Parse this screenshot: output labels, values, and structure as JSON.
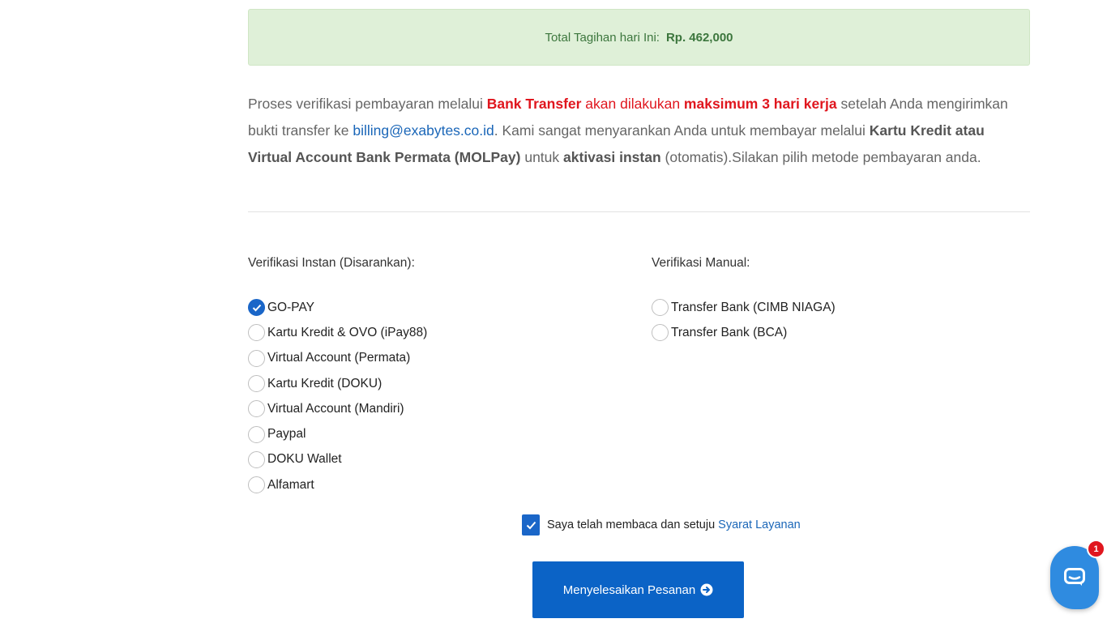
{
  "total": {
    "label": "Total Tagihan hari Ini:",
    "amount": "Rp. 462,000"
  },
  "notice": {
    "p1": "Proses verifikasi pembayaran melalui ",
    "bank_transfer": "Bank Transfer",
    "p2": " akan dilakukan ",
    "max_days": "maksimum 3 hari kerja",
    "p3": " setelah Anda mengirimkan bukti transfer ke ",
    "email": "billing@exabytes.co.id",
    "p4": ". Kami sangat menyarankan Anda untuk membayar melalui ",
    "recommended": "Kartu Kredit atau Virtual Account Bank Permata (MOLPay)",
    "p5": " untuk ",
    "instant": "aktivasi instan",
    "p6": " (otomatis).Silakan pilih metode pembayaran anda."
  },
  "instant_section": {
    "title": "Verifikasi Instan (Disarankan):",
    "options": [
      {
        "label": "GO-PAY",
        "checked": true
      },
      {
        "label": "Kartu Kredit & OVO (iPay88)",
        "checked": false
      },
      {
        "label": "Virtual Account (Permata)",
        "checked": false
      },
      {
        "label": "Kartu Kredit (DOKU)",
        "checked": false
      },
      {
        "label": "Virtual Account (Mandiri)",
        "checked": false
      },
      {
        "label": "Paypal",
        "checked": false
      },
      {
        "label": "DOKU Wallet",
        "checked": false
      },
      {
        "label": "Alfamart",
        "checked": false
      }
    ]
  },
  "manual_section": {
    "title": "Verifikasi Manual:",
    "options": [
      {
        "label": "Transfer Bank (CIMB NIAGA)",
        "checked": false
      },
      {
        "label": "Transfer Bank (BCA)",
        "checked": false
      }
    ]
  },
  "terms": {
    "text": "Saya telah membaca dan setuju",
    "link": "Syarat Layanan",
    "checked": true
  },
  "submit": {
    "label": "Menyelesaikan Pesanan",
    "icon": "arrow-circle-right-icon"
  },
  "chat": {
    "icon": "chat-bubble-icon",
    "badge": "1"
  },
  "colors": {
    "primary": "#0b63c6",
    "success_bg": "#dff0d8",
    "success_text": "#3c763d",
    "danger": "#e0161e",
    "link": "#1a66b8"
  }
}
